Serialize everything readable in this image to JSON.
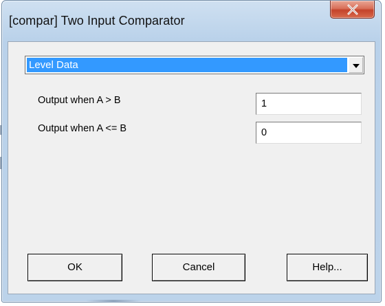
{
  "window": {
    "title": "[compar] Two Input Comparator"
  },
  "mode_select": {
    "value": "Level Data"
  },
  "params": [
    {
      "label": "Output when A > B",
      "value": "1"
    },
    {
      "label": "Output when A <= B",
      "value": "0"
    }
  ],
  "buttons": {
    "ok": "OK",
    "cancel": "Cancel",
    "help": "Help..."
  },
  "icons": {
    "close": "close-icon",
    "dropdown": "chevron-down-icon"
  },
  "colors": {
    "selection": "#3399ff",
    "close_button": "#c4432b",
    "dialog_face": "#f0f0f0",
    "frame": "#bcd3ea"
  }
}
